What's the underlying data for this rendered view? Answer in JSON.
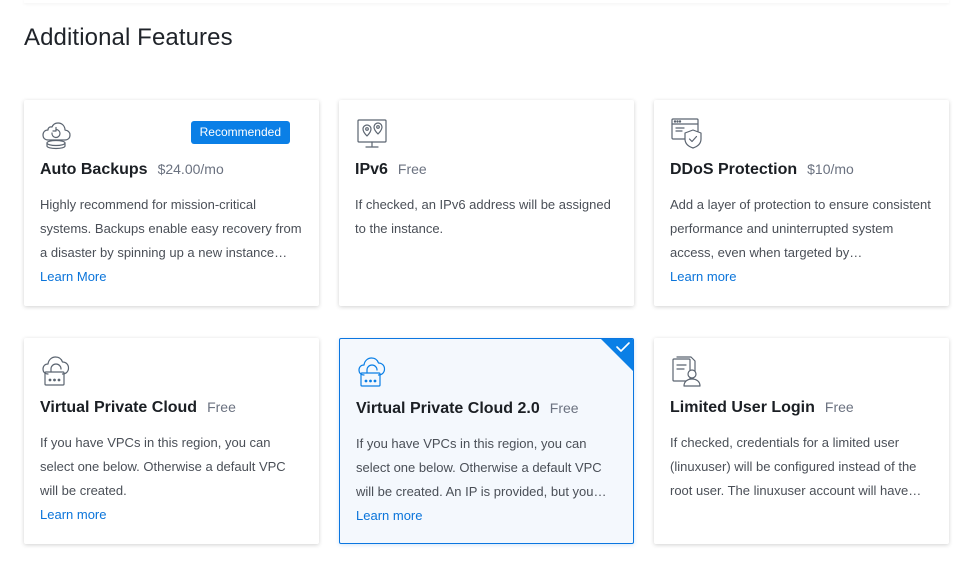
{
  "section": {
    "title": "Additional Features"
  },
  "colors": {
    "accent": "#0a7fe6",
    "link": "#0a74da",
    "selected_bg": "#f4f8fd"
  },
  "cards": [
    {
      "icon": "cloud-backup-icon",
      "title": "Auto Backups",
      "price": "$24.00/mo",
      "badge": "Recommended",
      "description": "Highly recommend for mission-critical systems. Backups enable easy recovery from a disaster by spinning up a new instance…",
      "link": "Learn More",
      "selected": false
    },
    {
      "icon": "map-pin-icon",
      "title": "IPv6",
      "price": "Free",
      "description": "If checked, an IPv6 address will be assigned to the instance.",
      "selected": false
    },
    {
      "icon": "browser-shield-icon",
      "title": "DDoS Protection",
      "price": "$10/mo",
      "description": "Add a layer of protection to ensure consistent performance and uninterrupted system access, even when targeted by…",
      "link": "Learn more",
      "selected": false
    },
    {
      "icon": "cloud-lock-icon",
      "title": "Virtual Private Cloud",
      "price": "Free",
      "description": "If you have VPCs in this region, you can select one below. Otherwise a default VPC will be created.",
      "link": "Learn more",
      "selected": false
    },
    {
      "icon": "cloud-lock-icon",
      "title": "Virtual Private Cloud 2.0",
      "price": "Free",
      "description": "If you have VPCs in this region, you can select one below. Otherwise a default VPC will be created. An IP is provided, but you…",
      "link": "Learn more",
      "selected": true
    },
    {
      "icon": "user-document-icon",
      "title": "Limited User Login",
      "price": "Free",
      "description": "If checked, credentials for a limited user (linuxuser) will be configured instead of the root user. The linuxuser account will have…",
      "selected": false
    }
  ]
}
